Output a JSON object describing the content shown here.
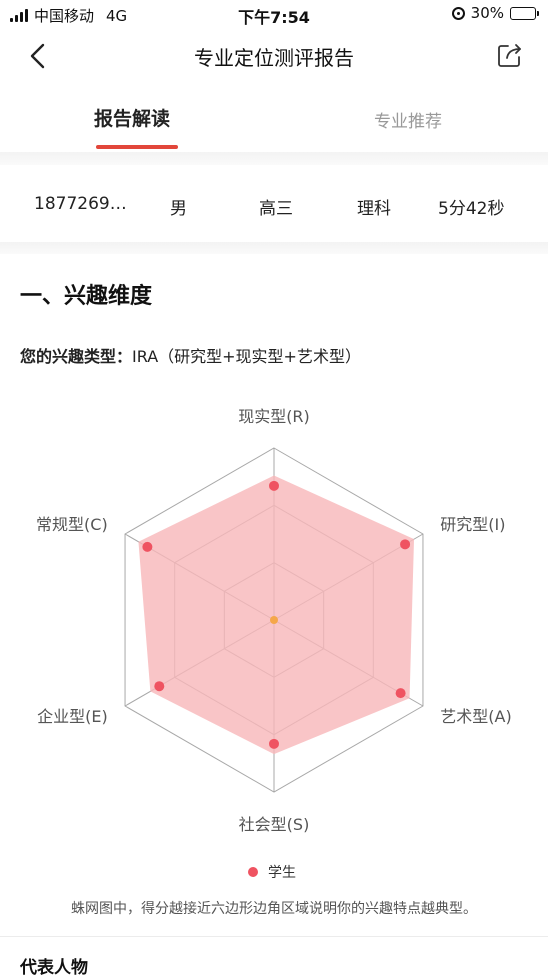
{
  "status_bar": {
    "carrier": "中国移动",
    "network": "4G",
    "time": "下午7:54",
    "battery": "30%",
    "battery_level": 0.3
  },
  "nav": {
    "title": "专业定位测评报告"
  },
  "tabs": [
    {
      "label": "报告解读",
      "active": true
    },
    {
      "label": "专业推荐",
      "active": false
    }
  ],
  "profile": {
    "phone": "1877269…",
    "gender": "男",
    "grade": "高三",
    "subject": "理科",
    "duration": "5分42秒"
  },
  "section": {
    "title": "一、兴趣维度",
    "type_label": "您的兴趣类型：",
    "type_value": "IRA（研究型+现实型+艺术型）"
  },
  "chart_data": {
    "type": "radar",
    "axes": [
      "现实型(R)",
      "研究型(I)",
      "艺术型(A)",
      "社会型(S)",
      "企业型(E)",
      "常规型(C)"
    ],
    "series": [
      {
        "name": "学生",
        "values": [
          0.78,
          0.88,
          0.85,
          0.72,
          0.77,
          0.85
        ]
      }
    ],
    "rings": 3,
    "max": 1,
    "colors": {
      "point": "#ef5361",
      "fill": "#f8b6b9",
      "center": "#f5a74a",
      "grid": "#a8a8a8"
    }
  },
  "legend": {
    "label": "学生"
  },
  "caption": "蛛网图中，得分越接近六边形边角区域说明你的兴趣特点越典型。",
  "next_section": {
    "title": "代表人物"
  }
}
